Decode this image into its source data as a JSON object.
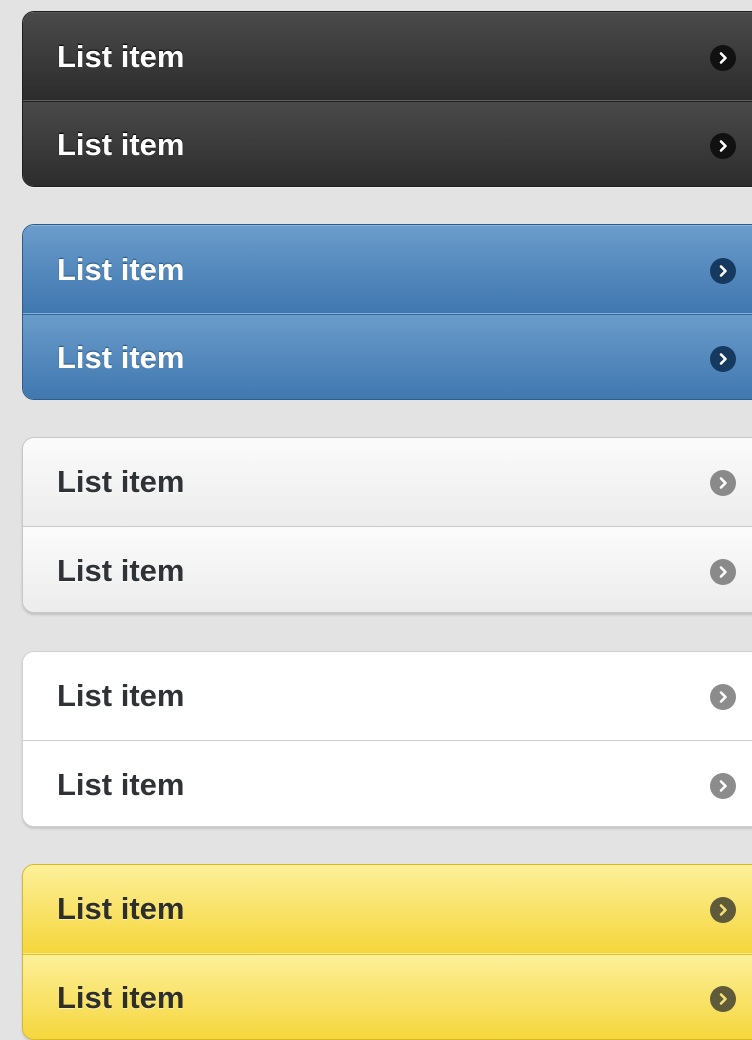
{
  "groups": [
    {
      "theme": "dark",
      "accent": "#2c2c2c",
      "items": [
        {
          "label": "List item",
          "icon": "chevron-right-icon"
        },
        {
          "label": "List item",
          "icon": "chevron-right-icon"
        }
      ]
    },
    {
      "theme": "blue",
      "accent": "#4a7fb5",
      "items": [
        {
          "label": "List item",
          "icon": "chevron-right-icon"
        },
        {
          "label": "List item",
          "icon": "chevron-right-icon"
        }
      ]
    },
    {
      "theme": "light-gray",
      "accent": "#f2f2f2",
      "items": [
        {
          "label": "List item",
          "icon": "chevron-right-icon"
        },
        {
          "label": "List item",
          "icon": "chevron-right-icon"
        }
      ]
    },
    {
      "theme": "white",
      "accent": "#ffffff",
      "items": [
        {
          "label": "List item",
          "icon": "chevron-right-icon"
        },
        {
          "label": "List item",
          "icon": "chevron-right-icon"
        }
      ]
    },
    {
      "theme": "yellow",
      "accent": "#f7dc4a",
      "items": [
        {
          "label": "List item",
          "icon": "chevron-right-icon"
        },
        {
          "label": "List item",
          "icon": "chevron-right-icon"
        }
      ]
    }
  ]
}
